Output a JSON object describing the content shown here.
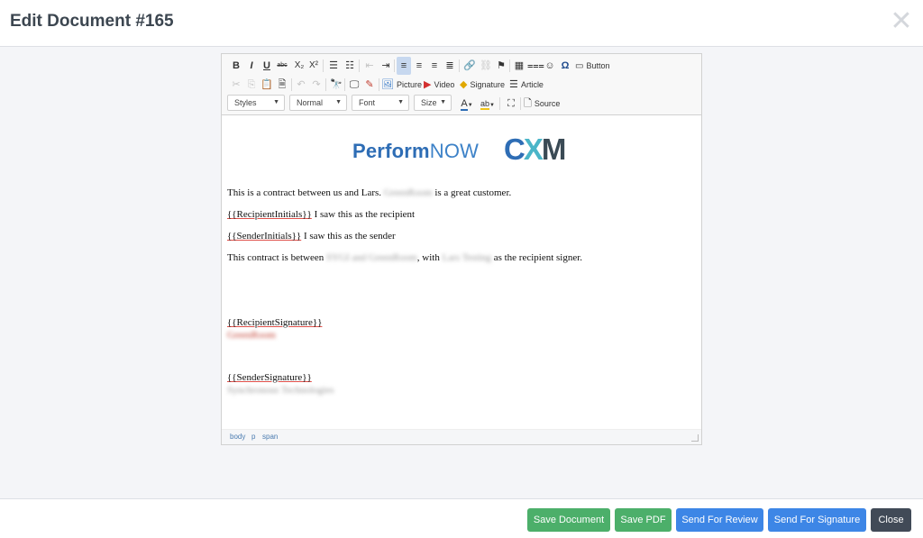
{
  "header": {
    "title": "Edit Document #165",
    "close_glyph": "✕"
  },
  "toolbar": {
    "picture_label": "Picture",
    "video_label": "Video",
    "signature_label": "Signature",
    "article_label": "Article",
    "button_label": "Button",
    "source_label": "Source",
    "styles_combo": "Styles",
    "format_combo": "Normal",
    "font_combo": "Font",
    "size_combo": "Size"
  },
  "logo": {
    "brand_part1": "Perform",
    "brand_part2": "NOW",
    "cx_c": "C",
    "cx_x": "X",
    "cx_m": "M"
  },
  "content": {
    "p1_before": "This is a contract between us and Lars.",
    "p1_redacted": "GreenRoom",
    "p1_after": "is a great customer.",
    "p2_var": "{{RecipientInitials}}",
    "p2_text": "I saw this as the recipient",
    "p3_var": "{{SenderInitials}}",
    "p3_text": "I saw this as the sender",
    "p4_before": "This contract is between",
    "p4_redacted1": "SYGI and GreenRoom",
    "p4_mid": ", with",
    "p4_redacted2": "Lars Testing",
    "p4_after": "as the recipient signer.",
    "recipient_sig_var": "{{RecipientSignature}}",
    "recipient_sig_name": "GreenRoom",
    "sender_sig_var": "{{SenderSignature}}",
    "sender_sig_name": "Synchronous Technologies"
  },
  "statusbar": {
    "crumb_body": "body",
    "crumb_p": "p",
    "crumb_span": "span"
  },
  "footer": {
    "save_document": "Save Document",
    "save_pdf": "Save PDF",
    "send_review": "Send For Review",
    "send_signature": "Send For Signature",
    "close": "Close"
  },
  "colors": {
    "save_green": "#4caf6a",
    "send_blue": "#3d86e6",
    "close_dark": "#414a57",
    "brand_blue": "#2e6db5",
    "brand_teal": "#4ab5c8"
  }
}
